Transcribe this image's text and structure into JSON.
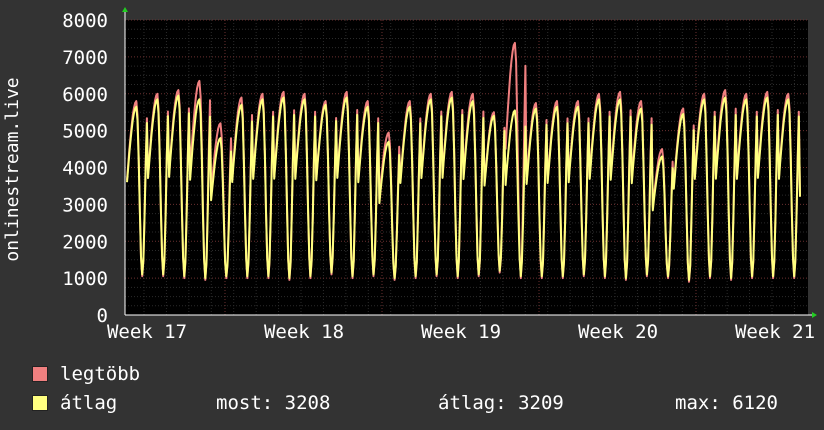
{
  "chart_data": {
    "type": "line",
    "ylabel": "onlinestream.live",
    "ylim": [
      0,
      8000
    ],
    "yticks": [
      0,
      1000,
      2000,
      3000,
      4000,
      5000,
      6000,
      7000,
      8000
    ],
    "xticks": [
      "Week 17",
      "Week 18",
      "Week 19",
      "Week 20",
      "Week 21"
    ],
    "days": 28,
    "grid": true,
    "series": [
      {
        "name": "legtöbb",
        "color": "#f08080",
        "daily_max": [
          5800,
          6000,
          6100,
          6350,
          5200,
          5900,
          6000,
          6050,
          6000,
          5800,
          6050,
          5800,
          4950,
          5800,
          6000,
          6050,
          6000,
          5500,
          7380,
          5750,
          5800,
          5800,
          6000,
          6050,
          5800,
          4500,
          5600,
          6000,
          6100,
          6000,
          6050,
          6000
        ],
        "daily_min": [
          1050,
          1050,
          1000,
          950,
          1000,
          1000,
          1000,
          950,
          1000,
          1100,
          1000,
          1050,
          950,
          1000,
          1050,
          1000,
          1050,
          1150,
          1000,
          1000,
          1000,
          1050,
          1000,
          950,
          1050,
          1000,
          900,
          1000,
          950,
          1000,
          1000,
          1000
        ]
      },
      {
        "name": "átlag",
        "color": "#ffff80",
        "daily_max": [
          5650,
          5850,
          5950,
          5850,
          4800,
          5700,
          5850,
          5900,
          5850,
          5700,
          5900,
          5650,
          4700,
          5650,
          5850,
          5900,
          5800,
          5400,
          5550,
          5600,
          5650,
          5650,
          5850,
          5850,
          5600,
          4300,
          5450,
          5850,
          5900,
          5850,
          5900,
          5850
        ],
        "daily_min": [
          1100,
          1100,
          1050,
          1000,
          1050,
          1050,
          1050,
          1000,
          1050,
          1150,
          1050,
          1100,
          1000,
          1050,
          1100,
          1050,
          1100,
          1200,
          1050,
          1050,
          1050,
          1100,
          1050,
          1000,
          1100,
          1050,
          950,
          1050,
          1000,
          1050,
          1050,
          1050
        ]
      }
    ]
  },
  "legend": {
    "max_label": "legtöbb",
    "avg_label": "átlag",
    "now": "most: 3208",
    "average": "átlag: 3209",
    "maximum": "max: 6120"
  },
  "colors": {
    "background": "#333333",
    "plot_background": "#000000",
    "grid_major": "#6b3030",
    "axis_arrow": "#22cc22"
  }
}
